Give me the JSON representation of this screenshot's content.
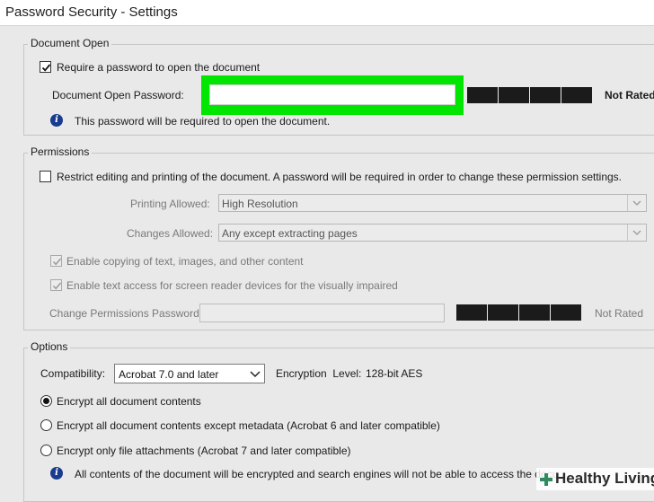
{
  "window": {
    "title": "Password Security - Settings"
  },
  "document_open": {
    "legend": "Document Open",
    "require_label": "Require a password to open the document",
    "require_checked": true,
    "password_label": "Document Open Password:",
    "password_value": "",
    "highlight_color": "#00e600",
    "strength_label": "Not Rated",
    "info_text": "This password will be required to open the document."
  },
  "permissions": {
    "legend": "Permissions",
    "restrict_label": "Restrict editing and printing of the document. A password will be required in order to change these permission settings.",
    "restrict_checked": false,
    "printing_label": "Printing Allowed:",
    "printing_value": "High Resolution",
    "changes_label": "Changes Allowed:",
    "changes_value": "Any except extracting pages",
    "copy_label": "Enable copying of text, images, and other content",
    "screen_reader_label": "Enable text access for screen reader devices for the visually impaired",
    "change_password_label": "Change Permissions Password:",
    "change_password_value": "",
    "strength_label": "Not Rated"
  },
  "options": {
    "legend": "Options",
    "compat_label": "Compatibility:",
    "compat_value": "Acrobat 7.0 and later",
    "encryption_label": "Encryption  Level:",
    "encryption_value": "128-bit AES",
    "radio_all": "Encrypt all document contents",
    "radio_except_metadata": "Encrypt all document contents except metadata (Acrobat 6 and later compatible)",
    "radio_attachments": "Encrypt only file attachments (Acrobat 7 and later compatible)",
    "selected": "radio_all",
    "info_text": "All contents of the document will be encrypted and search engines will not be able to access the docu"
  },
  "watermark": {
    "text": "Healthy Living"
  }
}
